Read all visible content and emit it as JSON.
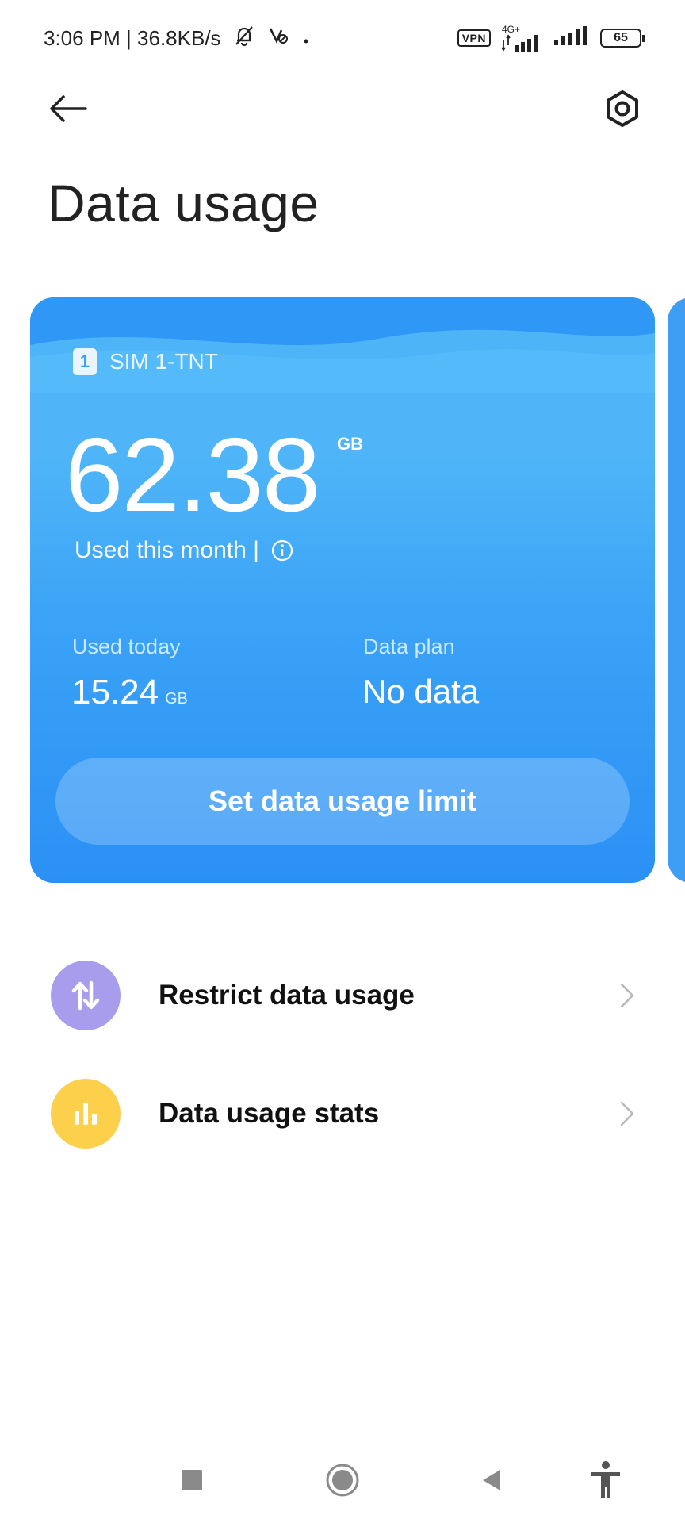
{
  "status_bar": {
    "time_speed": "3:06 PM | 36.8KB/s",
    "vpn": "VPN",
    "network_type": "4G+",
    "battery": "65"
  },
  "header": {
    "title": "Data usage"
  },
  "card": {
    "sim_number": "1",
    "sim_label": "SIM 1-TNT",
    "used_month_value": "62.38",
    "used_month_unit": "GB",
    "used_month_label": "Used this month |",
    "used_today_label": "Used today",
    "used_today_value": "15.24",
    "used_today_unit": "GB",
    "data_plan_label": "Data plan",
    "data_plan_value": "No data",
    "limit_button": "Set data usage limit",
    "colors": {
      "card": "#3a9ff7",
      "accent_purple": "#a89cec",
      "accent_yellow": "#fdd04c"
    }
  },
  "list": {
    "items": [
      {
        "label": "Restrict data usage",
        "icon": "arrows-updown-icon"
      },
      {
        "label": "Data usage stats",
        "icon": "bar-chart-icon"
      }
    ]
  }
}
